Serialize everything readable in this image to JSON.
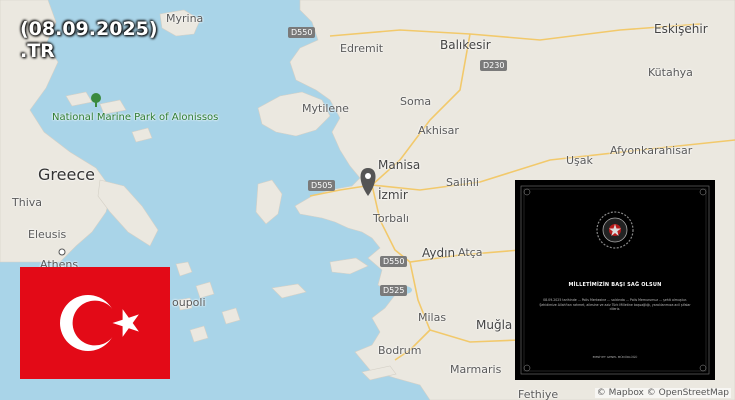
{
  "overlay": {
    "date": "(08.09.2025)",
    "domain": ".TR"
  },
  "colors": {
    "sea": "#a9d4e8",
    "land": "#ebe8e0",
    "flag_red": "#e30a17",
    "flag_white": "#ffffff",
    "notice_bg": "#000000"
  },
  "map": {
    "places": {
      "myrina": "Myrina",
      "edremit": "Edremit",
      "balikesir": "Balıkesir",
      "eskisehir": "Eskişehir",
      "kutahya": "Kütahya",
      "mytilene": "Mytilene",
      "soma": "Soma",
      "akhisar": "Akhisar",
      "usak": "Uşak",
      "afyonkarahisar": "Afyonkarahisar",
      "manisa": "Manisa",
      "greece": "Greece",
      "izmir": "İzmir",
      "salihli": "Salihli",
      "thiva": "Thiva",
      "torbali": "Torbalı",
      "elefsina": "Eleusis",
      "aydin": "Aydın",
      "atca": "Atça",
      "athens": "Athens",
      "poupoli": "oupoli",
      "milas": "Milas",
      "mugla": "Muğla",
      "bodrum": "Bodrum",
      "marmaris": "Marmaris",
      "fethiye": "Fethiye"
    },
    "park": "National Marine Park of Alonissos",
    "roads": {
      "d550_north": "D550",
      "d230": "D230",
      "d505": "D505",
      "d550_south": "D550",
      "d525": "D525"
    }
  },
  "notice": {
    "title": "MİLLETİMİZİN BAŞI SAĞ OLSUN",
    "body": "08.09.2025 tarihinde ... Polis Merkezine ... saldırıda ... Polis Memurumuz ... şehit olmuştur. Şehidimize Allah'tan rahmet, ailesine ve aziz Türk Milletine başsağlığı, yaralılarımıza acil şifalar dileriz.",
    "footer": "EMNİYET GENEL MÜDÜRLÜĞÜ"
  },
  "attribution": "© Mapbox © OpenStreetMap"
}
